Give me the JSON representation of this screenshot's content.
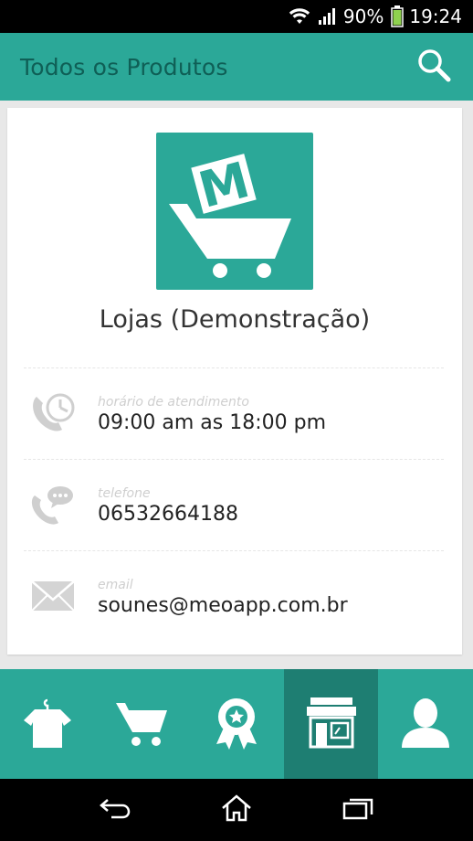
{
  "status_bar": {
    "battery": "90%",
    "time": "19:24"
  },
  "app_bar": {
    "title": "Todos os Produtos"
  },
  "store": {
    "name": "Lojas (Demonstração)",
    "logo_letter": "M",
    "info": [
      {
        "label": "horário de atendimento",
        "value": "09:00 am as 18:00 pm",
        "icon": "clock-phone-icon"
      },
      {
        "label": "telefone",
        "value": "06532664188",
        "icon": "phone-chat-icon"
      },
      {
        "label": "email",
        "value": "sounes@meoapp.com.br",
        "icon": "envelope-icon"
      }
    ]
  },
  "bottom_nav": [
    {
      "icon": "clothing-hanger-icon",
      "active": false
    },
    {
      "icon": "cart-icon",
      "active": false
    },
    {
      "icon": "award-badge-icon",
      "active": false
    },
    {
      "icon": "store-icon",
      "active": true
    },
    {
      "icon": "user-icon",
      "active": false
    }
  ],
  "colors": {
    "primary": "#2ba898",
    "primary_dark": "#1e7e72",
    "title_text": "#0f5f56"
  }
}
